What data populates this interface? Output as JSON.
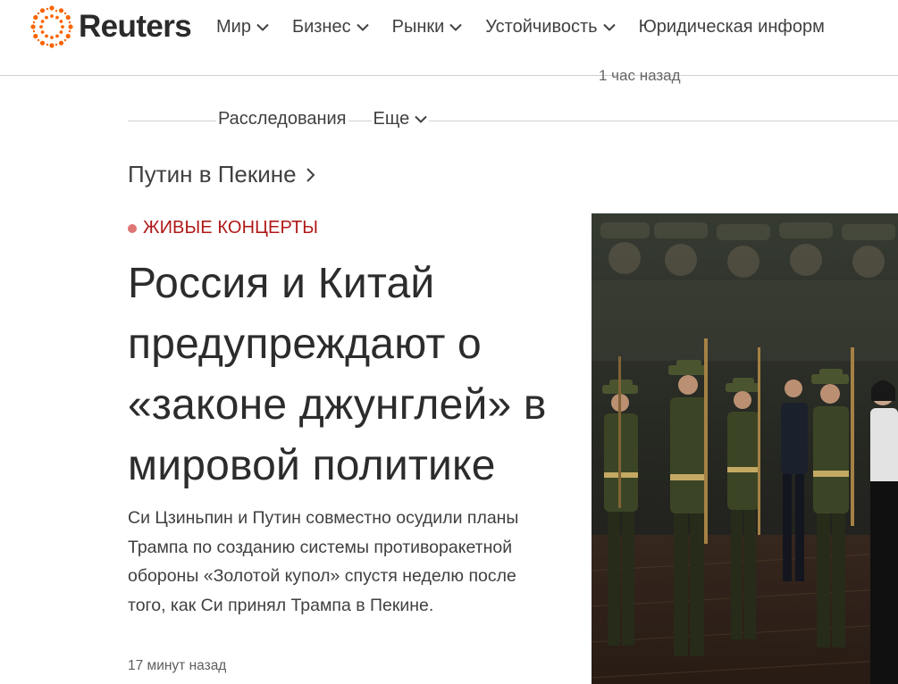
{
  "header": {
    "logo_text": "Reuters",
    "brand_color": "#fa6400",
    "nav": [
      {
        "label": "Мир"
      },
      {
        "label": "Бизнес"
      },
      {
        "label": "Рынки"
      },
      {
        "label": "Устойчивость"
      },
      {
        "label": "Юридическая информ"
      }
    ]
  },
  "peek_text": "1 час назад",
  "subnav": [
    {
      "label": "Расследования"
    },
    {
      "label": "Еще"
    }
  ],
  "breadcrumb": {
    "label": "Путин в Пекине"
  },
  "article": {
    "kicker": "ЖИВЫЕ КОНЦЕРТЫ",
    "kicker_color": "#b01818",
    "headline": "Россия и Китай предупреждают о «законе джунглей» в мировой политике",
    "dek": "Си Цзиньпин и Путин совместно осудили планы Трампа по созданию системы противоракетной обороны «Золотой купол» спустя неделю после того, как Си принял Трампа в Пекине.",
    "time": "17 минут назад"
  },
  "hero_image": {
    "icon": "photo-honor-guard"
  }
}
